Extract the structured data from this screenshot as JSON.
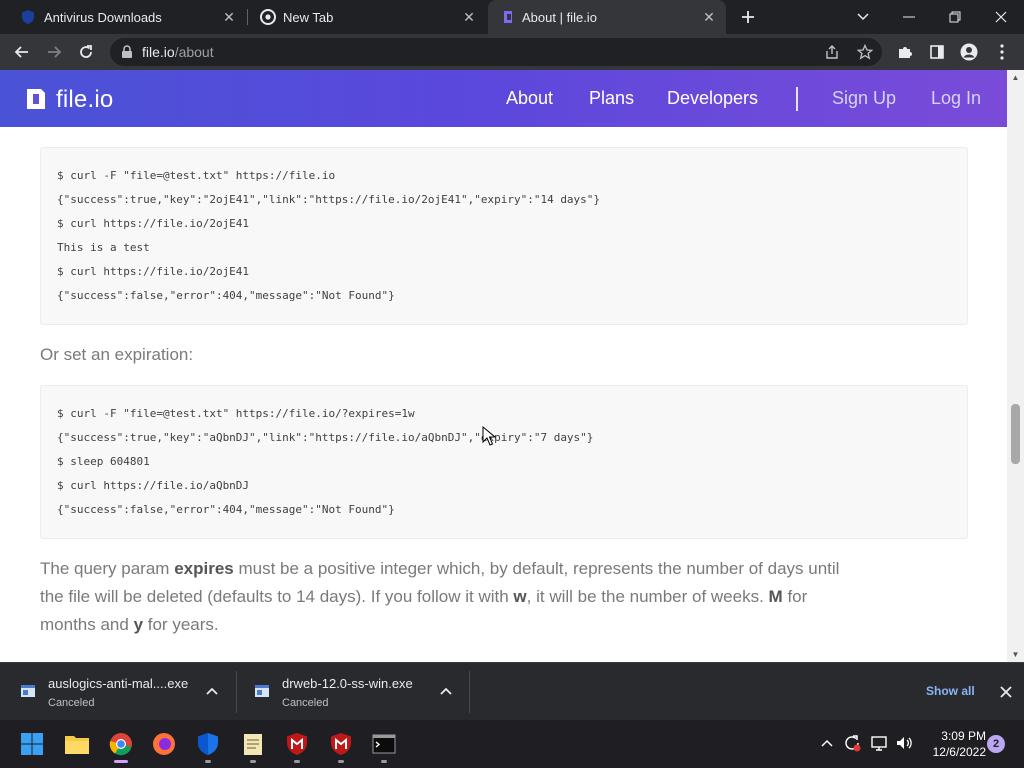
{
  "browser": {
    "tabs": [
      {
        "title": "Antivirus Downloads",
        "favicon": "shield-favicon",
        "active": false
      },
      {
        "title": "New Tab",
        "favicon": "chrome-favicon",
        "active": false
      },
      {
        "title": "About | file.io",
        "favicon": "fileio-favicon",
        "active": true
      }
    ],
    "url_host": "file.io",
    "url_path": "/about"
  },
  "site": {
    "logo_text": "file.io",
    "nav": {
      "about": "About",
      "plans": "Plans",
      "developers": "Developers",
      "signup": "Sign Up",
      "login": "Log In"
    },
    "brand_color": "#5a4bdb"
  },
  "content": {
    "code_block_1": [
      "$ curl -F \"file=@test.txt\" https://file.io",
      "{\"success\":true,\"key\":\"2ojE41\",\"link\":\"https://file.io/2ojE41\",\"expiry\":\"14 days\"}",
      "$ curl https://file.io/2ojE41",
      "This is a test",
      "$ curl https://file.io/2ojE41",
      "{\"success\":false,\"error\":404,\"message\":\"Not Found\"}"
    ],
    "expiration_heading": "Or set an expiration:",
    "code_block_2": [
      "$ curl -F \"file=@test.txt\" https://file.io/?expires=1w",
      "{\"success\":true,\"key\":\"aQbnDJ\",\"link\":\"https://file.io/aQbnDJ\",\"expiry\":\"7 days\"}",
      "$ sleep 604801",
      "$ curl https://file.io/aQbnDJ",
      "{\"success\":false,\"error\":404,\"message\":\"Not Found\"}"
    ],
    "para": {
      "l1_a": "The query param ",
      "l1_b": "expires",
      "l1_c": " must be a positive integer which, by default, represents the number of days until",
      "l2_a": "the file will be deleted (defaults to 14 days). If you follow it with ",
      "l2_b": "w",
      "l2_c": ", it will be the number of weeks. ",
      "l2_d": "M",
      "l2_e": " for",
      "l3_a": "months and ",
      "l3_b": "y",
      "l3_c": " for years."
    }
  },
  "downloads": {
    "items": [
      {
        "name": "auslogics-anti-mal....exe",
        "status": "Canceled"
      },
      {
        "name": "drweb-12.0-ss-win.exe",
        "status": "Canceled"
      }
    ],
    "show_all": "Show all"
  },
  "taskbar": {
    "time": "3:09 PM",
    "date": "12/6/2022",
    "notification_count": "2"
  }
}
